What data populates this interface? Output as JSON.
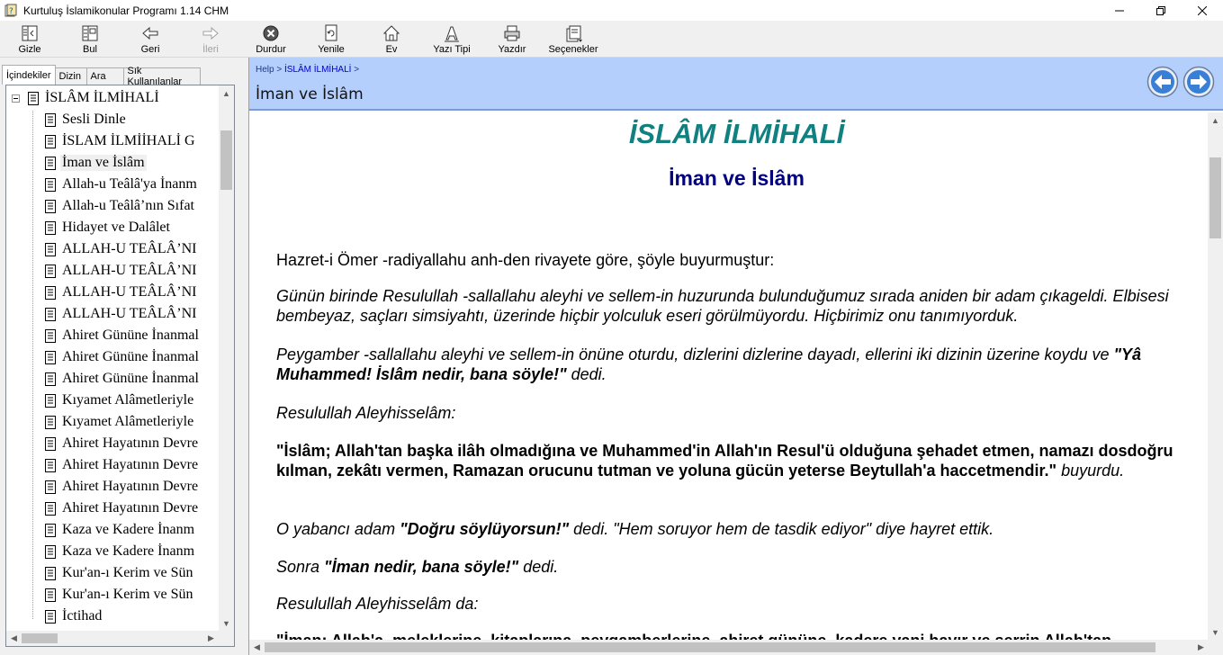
{
  "window": {
    "title": "Kurtuluş İslamikonular Programı 1.14 CHM",
    "icon": "chm-help-icon"
  },
  "toolbar": {
    "buttons": [
      {
        "label": "Gizle",
        "icon": "hide-pane-icon"
      },
      {
        "label": "Bul",
        "icon": "locate-icon"
      },
      {
        "label": "Geri",
        "icon": "back-arrow-icon"
      },
      {
        "label": "İleri",
        "icon": "forward-arrow-icon",
        "disabled": true
      },
      {
        "label": "Durdur",
        "icon": "stop-icon"
      },
      {
        "label": "Yenile",
        "icon": "refresh-icon"
      },
      {
        "label": "Ev",
        "icon": "home-icon"
      },
      {
        "label": "Yazı Tipi",
        "icon": "font-icon"
      },
      {
        "label": "Yazdır",
        "icon": "print-icon"
      },
      {
        "label": "Seçenekler",
        "icon": "options-icon"
      }
    ]
  },
  "tabs": [
    {
      "label": "İçindekiler",
      "active": true
    },
    {
      "label": "Dizin",
      "active": false
    },
    {
      "label": "Ara",
      "active": false
    },
    {
      "label": "Sık Kullanılanlar",
      "active": false
    }
  ],
  "tree": {
    "root": "İSLÂM İLMİHALİ",
    "items": [
      "Sesli Dinle",
      "İSLAM İLMİİHALİ G",
      "İman ve İslâm",
      "Allah-u Teâlâ'ya İnanm",
      "Allah-u Teâlâ’nın Sıfat",
      "Hidayet ve Dalâlet",
      "ALLAH-U TEÂLÂ’NI",
      "ALLAH-U TEÂLÂ’NI",
      "ALLAH-U TEÂLÂ’NI",
      "ALLAH-U TEÂLÂ’NI",
      "Ahiret Gününe İnanmal",
      "Ahiret Gününe İnanmal",
      "Ahiret Gününe İnanmal",
      "Kıyamet Alâmetleriyle",
      "Kıyamet Alâmetleriyle",
      "Ahiret Hayatının Devre",
      "Ahiret Hayatının Devre",
      "Ahiret Hayatının Devre",
      "Ahiret Hayatının Devre",
      "Kaza ve Kadere İnanm",
      "Kaza ve Kadere İnanm",
      "Kur'an-ı Kerim ve Sün",
      "Kur'an-ı Kerim ve Sün",
      "İctihad"
    ],
    "selected_index": 2
  },
  "header": {
    "breadcrumb_prefix": "Help >",
    "breadcrumb_link": "İSLÂM İLMİHALİ",
    "breadcrumb_suffix": ">",
    "topic_title": "İman ve İslâm"
  },
  "content": {
    "title": "İSLÂM İLMİHALİ",
    "subtitle": "İman ve İslâm",
    "p1": "Hazret-i Ömer -radiyallahu anh-den rivayete göre, şöyle buyurmuştur:",
    "p2": "Günün birinde Resulullah -sallallahu aleyhi ve sellem-in huzurunda bulunduğumuz sırada aniden bir adam çıkageldi. Elbisesi bembeyaz, saçları simsiyahtı, üzerinde hiçbir yolculuk eseri görülmüyordu. Hiçbirimiz onu tanımıyorduk.",
    "p3a": "Peygamber -sallallahu aleyhi ve sellem-in önüne oturdu, dizlerini dizlerine dayadı, ellerini iki dizinin üzerine koydu ve",
    "p3b": "\"Yâ Muhammed! İslâm nedir, bana söyle!\"",
    "p3c": " dedi.",
    "p4": "Resulullah Aleyhisselâm:",
    "p5a": "\"İslâm; Allah'tan başka ilâh olmadığına ve Muhammed'in Allah'ın Resul'ü olduğuna şehadet etmen, namazı dosdoğru kılman, zekâtı vermen, Ramazan orucunu tutman ve yoluna gücün yeterse Beytullah'a haccetmendir.\"",
    "p5b": " buyurdu.",
    "p6a": "O yabancı adam ",
    "p6b": "\"Doğru söylüyorsun!\"",
    "p6c": " dedi. \"Hem soruyor hem de tasdik ediyor\" diye hayret ettik.",
    "p7a": "Sonra ",
    "p7b": "\"İman nedir, bana söyle!\"",
    "p7c": " dedi.",
    "p8": "Resulullah Aleyhisselâm da:",
    "p9": "\"İman; Allah'a, meleklerine, kitaplarına, peygamberlerine, ahiret gününe, kadere yani hayır ve şerrin Allah'tan"
  },
  "colors": {
    "title_teal": "#118080",
    "subtitle_navy": "#000080",
    "header_band": "#b4cffc"
  }
}
